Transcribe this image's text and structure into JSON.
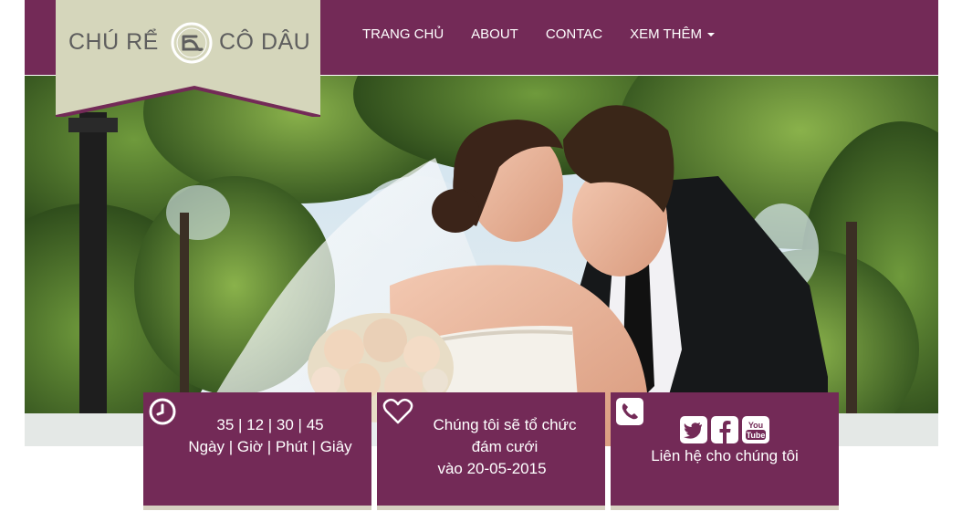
{
  "brand": {
    "left": "CHÚ RỂ",
    "right": "CÔ DÂU"
  },
  "nav": {
    "items": [
      {
        "label": "TRANG CHỦ"
      },
      {
        "label": "ABOUT"
      },
      {
        "label": "CONTAC"
      },
      {
        "label": "XEM THÊM"
      }
    ]
  },
  "countdown": {
    "values": "35 | 12 | 30 | 45",
    "units": "Ngày | Giờ | Phút | Giây",
    "icon": "clock-icon"
  },
  "wedding": {
    "line1": "Chúng tôi sẽ tổ chức",
    "line2": "đám cưới",
    "line3": "vào 20-05-2015",
    "icon": "heart-icon"
  },
  "contact": {
    "label": "Liên hệ cho chúng tôi",
    "icon": "phone-icon",
    "social": [
      "twitter-icon",
      "facebook-icon",
      "youtube-icon"
    ]
  },
  "colors": {
    "brand_purple": "#732a57",
    "logo_bg": "#d5d6bb",
    "card_border": "#d6cfc0"
  }
}
